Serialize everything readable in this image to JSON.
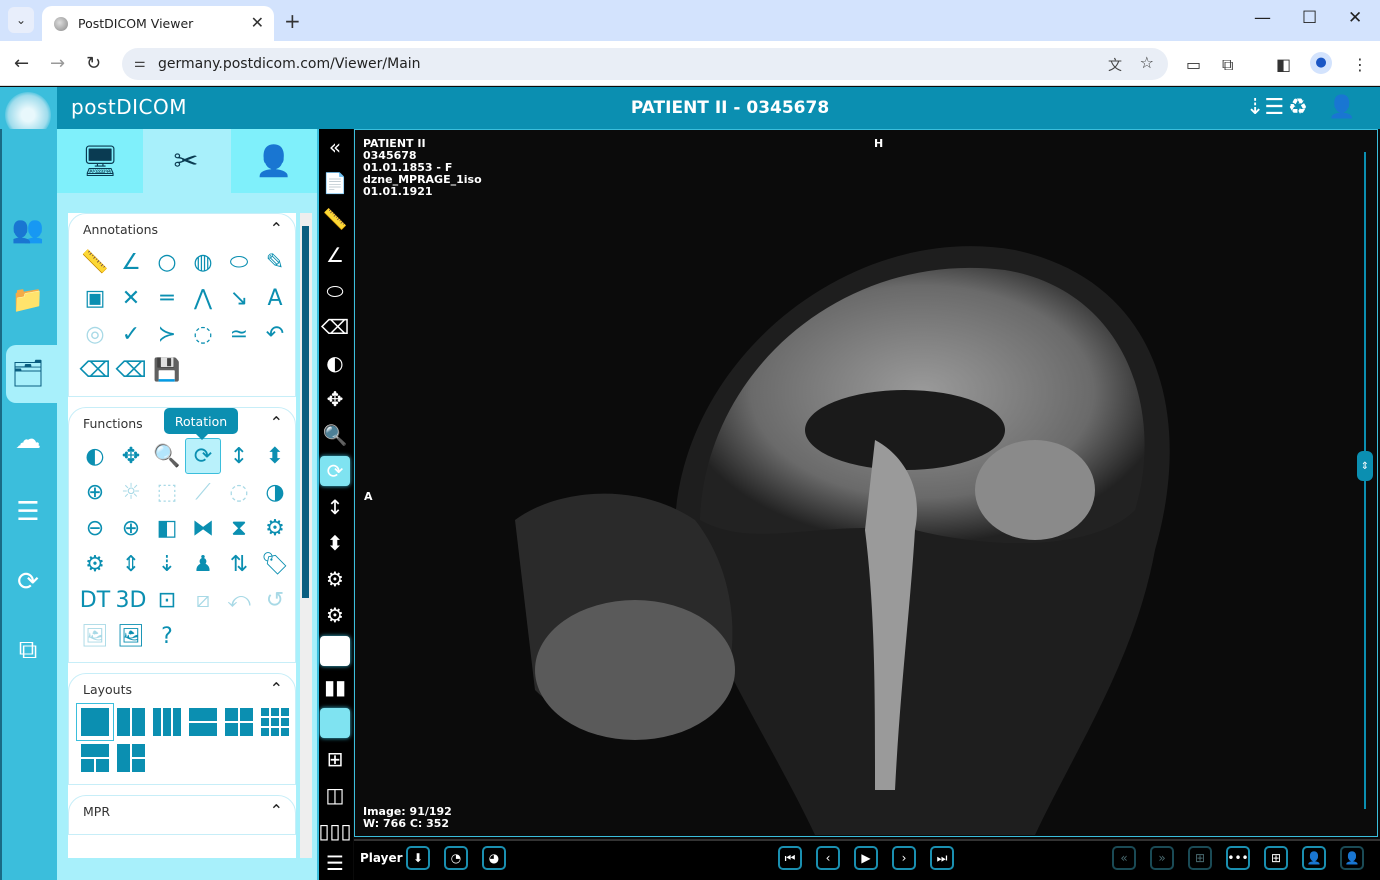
{
  "browser": {
    "tab_title": "PostDICOM Viewer",
    "url": "germany.postdicom.com/Viewer/Main",
    "new_tab": "+",
    "close_tab": "✕"
  },
  "app": {
    "brand": "postDICOM",
    "patient_title": "PATIENT II - 0345678"
  },
  "left_nav": [
    {
      "name": "patients-icon",
      "glyph": "👥"
    },
    {
      "name": "folder-icon",
      "glyph": "📁"
    },
    {
      "name": "viewer-icon",
      "glyph": "🗂"
    },
    {
      "name": "upload-icon",
      "glyph": "☁"
    },
    {
      "name": "search-list-icon",
      "glyph": "☰"
    },
    {
      "name": "sync-icon",
      "glyph": "⟳"
    },
    {
      "name": "remote-display-icon",
      "glyph": "⧉"
    }
  ],
  "panel": {
    "tabs": [
      {
        "name": "study-info-tab",
        "glyph": "🖥"
      },
      {
        "name": "tools-tab",
        "glyph": "✂"
      },
      {
        "name": "patient-info-tab",
        "glyph": "👤"
      }
    ],
    "annotations": {
      "title": "Annotations",
      "tools": [
        "📏",
        "∠",
        "○",
        "◍",
        "⬭",
        "✎",
        "▣",
        "✕",
        "═",
        "⋀",
        "↘",
        "A",
        "◎",
        "✓",
        "≻",
        "◌",
        "≃",
        "↶",
        "⌫",
        "⌫",
        "💾"
      ]
    },
    "functions": {
      "title": "Functions",
      "tooltip": "Rotation",
      "tools": [
        "◐",
        "✥",
        "🔍",
        "⟳",
        "↕",
        "⬍",
        "⊕",
        "☼",
        "⬚",
        "⟋",
        "◌",
        "◑",
        "⊖",
        "⊕",
        "◧",
        "⧓",
        "⧗",
        "⚙",
        "⚙",
        "⇕",
        "⇣",
        "♟",
        "⇅",
        "🏷",
        "DT",
        "3D",
        "⊡",
        "⧄",
        "⤺",
        "↺",
        "🖼",
        "🖼",
        "?"
      ],
      "dim_indices": [
        7,
        8,
        9,
        10,
        27,
        28,
        29,
        30
      ]
    },
    "layouts": {
      "title": "Layouts"
    },
    "mpr": {
      "title": "MPR"
    }
  },
  "viewer": {
    "patient_name": "PATIENT II",
    "patient_id": "0345678",
    "dob_sex": "01.01.1853 - F",
    "series": "dzne_MPRAGE_1iso",
    "study_date": "01.01.1921",
    "orientation_top": "H",
    "orientation_left": "A",
    "image_index": "Image: 91/192",
    "window_level": "W: 766 C: 352"
  },
  "player": {
    "label": "Player"
  }
}
